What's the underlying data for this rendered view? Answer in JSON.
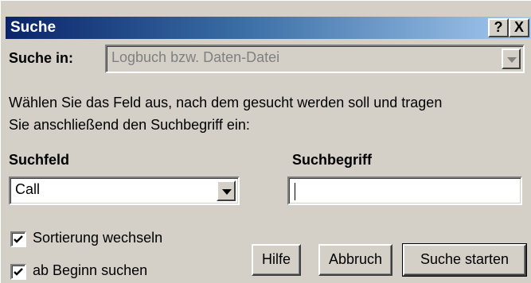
{
  "window": {
    "title": "Suche",
    "help_label": "?",
    "close_label": "X"
  },
  "search_in": {
    "label": "Suche in:",
    "value": "Logbuch bzw. Daten-Datei"
  },
  "instructions": {
    "line1": "Wählen Sie das Feld aus, nach dem gesucht werden soll und tragen",
    "line2": "Sie anschließend den Suchbegriff ein:"
  },
  "suchfeld": {
    "label": "Suchfeld",
    "value": "Call"
  },
  "suchbegriff": {
    "label": "Suchbegriff",
    "value": ""
  },
  "options": [
    {
      "label": "Sortierung wechseln",
      "checked": true
    },
    {
      "label": "ab Beginn suchen",
      "checked": true
    }
  ],
  "buttons": {
    "help": "Hilfe",
    "cancel": "Abbruch",
    "start": "Suche starten"
  }
}
